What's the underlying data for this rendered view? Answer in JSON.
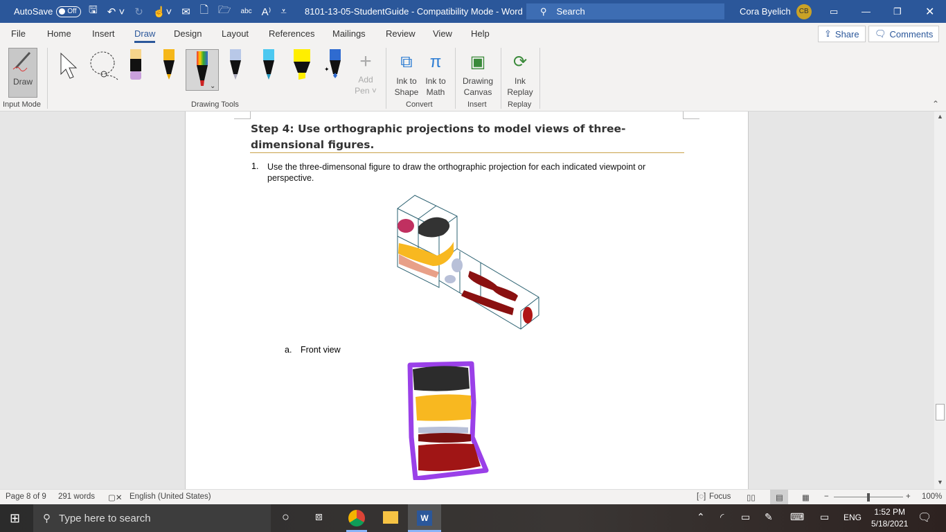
{
  "titlebar": {
    "autosave": "AutoSave",
    "autosave_state": "Off",
    "doc_title": "8101-13-05-StudentGuide  -  Compatibility Mode  -  Word",
    "search": "Search",
    "user": "Cora Byelich",
    "initials": "CB"
  },
  "tabs": [
    "File",
    "Home",
    "Insert",
    "Draw",
    "Design",
    "Layout",
    "References",
    "Mailings",
    "Review",
    "View",
    "Help"
  ],
  "share": "Share",
  "comments": "Comments",
  "ribbon": {
    "draw": "Draw",
    "input_mode": "Input Mode",
    "drawing_tools": "Drawing Tools",
    "add_pen_1": "Add",
    "add_pen_2": "Pen",
    "ink_shape_1": "Ink to",
    "ink_shape_2": "Shape",
    "ink_math_1": "Ink to",
    "ink_math_2": "Math",
    "convert": "Convert",
    "canvas_1": "Drawing",
    "canvas_2": "Canvas",
    "insert": "Insert",
    "replay_1": "Ink",
    "replay_2": "Replay",
    "replay": "Replay"
  },
  "document": {
    "heading": "Step 4: Use orthographic projections to model views of three-dimensional figures.",
    "item_num": "1.",
    "item_text": "Use the three-dimensonal figure to draw the orthographic projection for each indicated viewpoint or perspective.",
    "sub_letter": "a.",
    "sub_text": "Front view"
  },
  "status": {
    "page": "Page 8 of 9",
    "words": "291 words",
    "language": "English (United States)",
    "focus": "Focus",
    "zoom": "100%",
    "zoom_fraction": 0.5
  },
  "taskbar": {
    "search": "Type here to search",
    "lang": "ENG",
    "time": "1:52 PM",
    "date": "5/18/2021"
  }
}
